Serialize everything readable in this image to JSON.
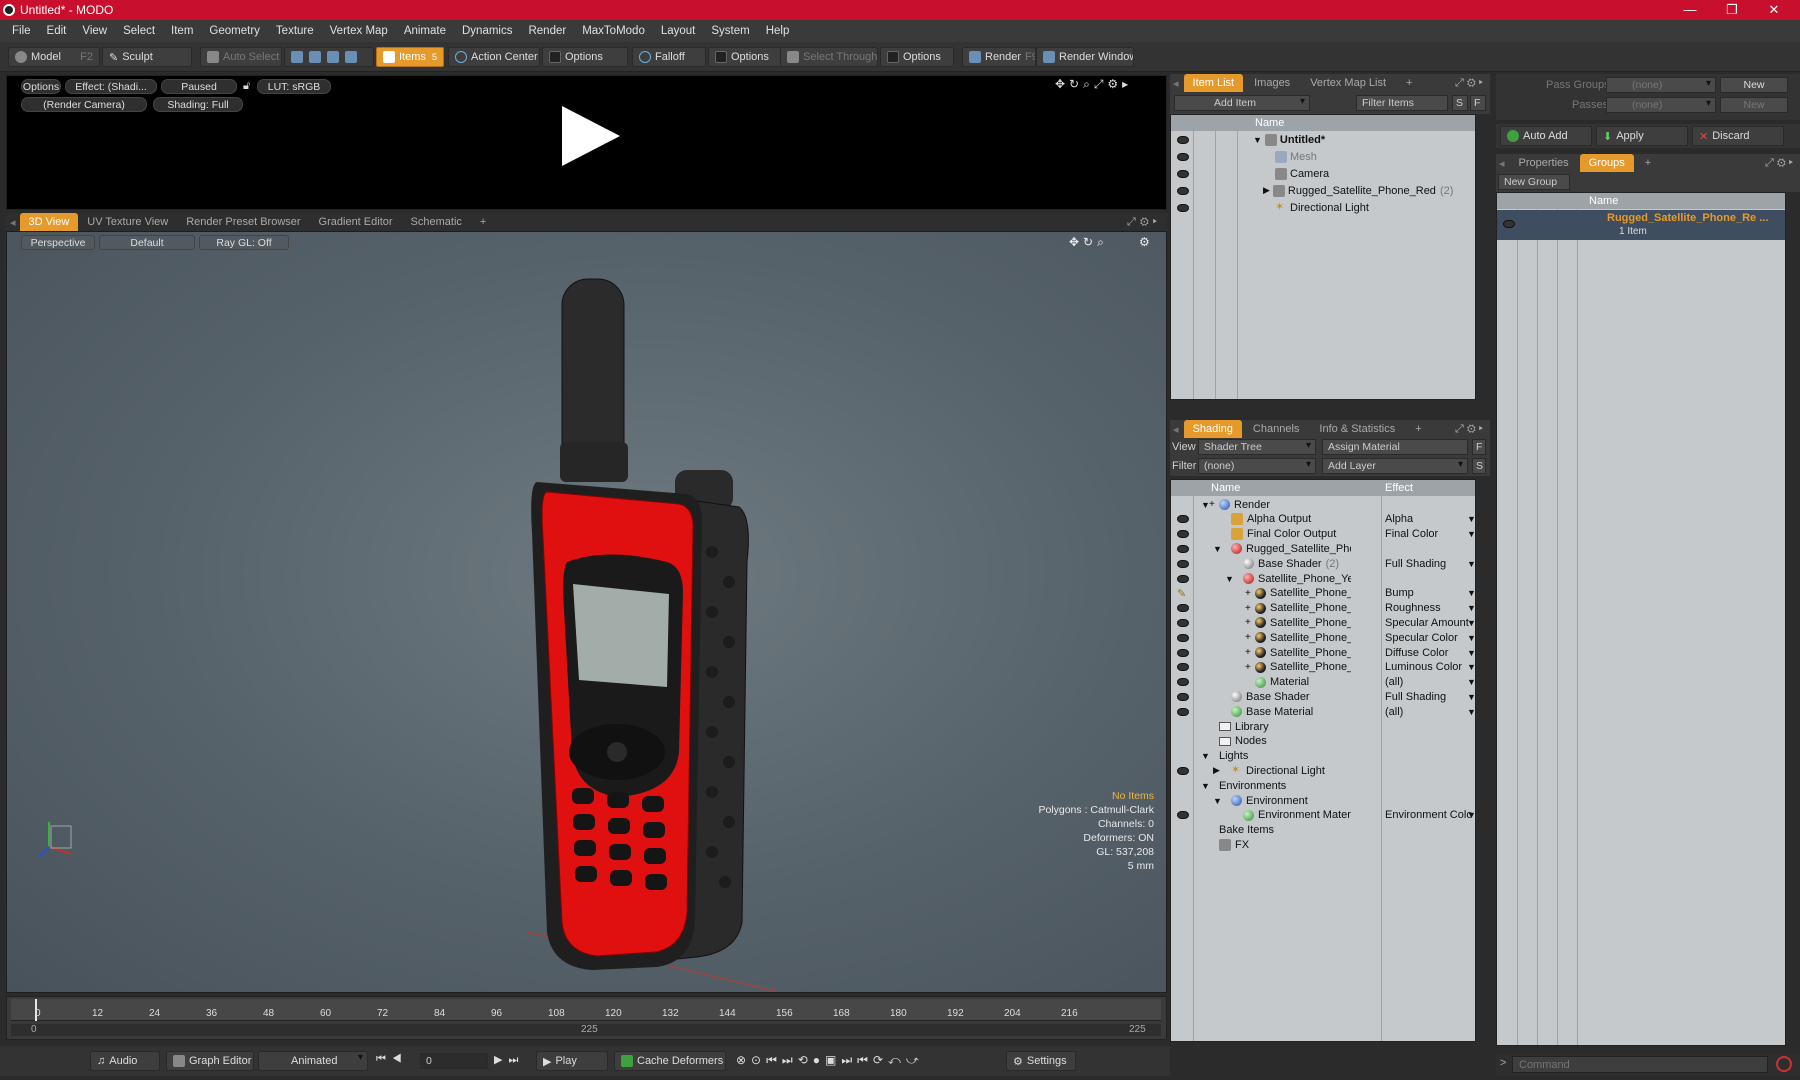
{
  "window": {
    "title": "Untitled* - MODO",
    "controls": [
      "—",
      "❐",
      "✕"
    ]
  },
  "menu": [
    "File",
    "Edit",
    "View",
    "Select",
    "Item",
    "Geometry",
    "Texture",
    "Vertex Map",
    "Animate",
    "Dynamics",
    "Render",
    "MaxToModo",
    "Layout",
    "System",
    "Help"
  ],
  "toolbar": {
    "model": "Model",
    "model_key": "F2",
    "sculpt": "Sculpt",
    "auto_select": "Auto Select",
    "items": "Items",
    "items_key": "5",
    "action_center": "Action Center",
    "options1": "Options",
    "falloff": "Falloff",
    "options2": "Options",
    "select_through": "Select Through",
    "options3": "Options",
    "render": "Render",
    "render_key": "F9",
    "render_window": "Render Window"
  },
  "render_preview": {
    "options": "Options",
    "effect": "Effect: (Shadi...",
    "paused": "Paused",
    "lut": "LUT: sRGB",
    "camera": "(Render Camera)",
    "shading": "Shading: Full"
  },
  "viewport_tabs": [
    "3D View",
    "UV Texture View",
    "Render Preset Browser",
    "Gradient Editor",
    "Schematic",
    "+"
  ],
  "viewport": {
    "perspective": "Perspective",
    "default": "Default",
    "raygl": "Ray GL: Off",
    "status": {
      "no_items": "No Items",
      "polygons": "Polygons : Catmull-Clark",
      "channels": "Channels: 0",
      "deformers": "Deformers: ON",
      "gl": "GL: 537,208",
      "scale": "5 mm"
    }
  },
  "timeline": {
    "ticks": [
      "0",
      "12",
      "24",
      "36",
      "48",
      "60",
      "72",
      "84",
      "96",
      "108",
      "120",
      "132",
      "144",
      "156",
      "168",
      "180",
      "192",
      "204",
      "216"
    ],
    "start": "0",
    "mid": "225",
    "end": "225"
  },
  "bottombar": {
    "audio": "Audio",
    "graph_editor": "Graph Editor",
    "animated": "Animated",
    "frame": "0",
    "play": "Play",
    "cache_deformers": "Cache Deformers",
    "settings": "Settings"
  },
  "item_list": {
    "tabs": [
      "Item List",
      "Images",
      "Vertex Map List",
      "+"
    ],
    "add_item": "Add Item",
    "filter_items": "Filter Items",
    "s": "S",
    "f": "F",
    "name_col": "Name",
    "rows": [
      {
        "label": "Untitled*",
        "bold": true
      },
      {
        "label": "Mesh",
        "dim": true
      },
      {
        "label": "Camera"
      },
      {
        "label": "Rugged_Satellite_Phone_Red",
        "suffix": "(2)"
      },
      {
        "label": "Directional Light"
      }
    ]
  },
  "groups_panel": {
    "pass_groups": "Pass Groups",
    "passes": "Passes",
    "none": "(none)",
    "new": "New",
    "auto_add": "Auto Add",
    "apply": "Apply",
    "discard": "Discard",
    "tabs": [
      "Properties",
      "Groups",
      "+"
    ],
    "new_group": "New Group",
    "name_col": "Name",
    "group_name": "Rugged_Satellite_Phone_Re ...",
    "group_count": "1 Item"
  },
  "shading": {
    "tabs": [
      "Shading",
      "Channels",
      "Info & Statistics",
      "+"
    ],
    "view_label": "View",
    "view_value": "Shader Tree",
    "assign_material": "Assign Material",
    "f": "F",
    "filter_label": "Filter",
    "filter_value": "(none)",
    "add_layer": "Add Layer",
    "s": "S",
    "name_col": "Name",
    "effect_col": "Effect",
    "rows": [
      {
        "name": "Render",
        "effect": "",
        "indent": 0
      },
      {
        "name": "Alpha Output",
        "effect": "Alpha",
        "indent": 1
      },
      {
        "name": "Final Color Output",
        "effect": "Final Color",
        "indent": 1
      },
      {
        "name": "Rugged_Satellite_Phone_ ...",
        "effect": "",
        "indent": 1
      },
      {
        "name": "Base Shader",
        "suffix": "(2)",
        "effect": "Full Shading",
        "indent": 2
      },
      {
        "name": "Satellite_Phone_Yellow",
        "suffix": "(...",
        "effect": "",
        "indent": 2
      },
      {
        "name": "Satellite_Phone_Yello ...",
        "effect": "Bump",
        "indent": 3
      },
      {
        "name": "Satellite_Phone_Gloss...",
        "effect": "Roughness",
        "indent": 3
      },
      {
        "name": "Satellite_Phone_Refle...",
        "effect": "Specular Amount",
        "indent": 3
      },
      {
        "name": "Satellite_Phone_Refle...",
        "effect": "Specular Color",
        "indent": 3
      },
      {
        "name": "Satellite_Phone_Yello ...",
        "effect": "Diffuse Color",
        "indent": 3
      },
      {
        "name": "Satellite_Phone_Emis ...",
        "effect": "Luminous Color",
        "indent": 3
      },
      {
        "name": "Material",
        "effect": "(all)",
        "indent": 3
      },
      {
        "name": "Base Shader",
        "effect": "Full Shading",
        "indent": 1
      },
      {
        "name": "Base Material",
        "effect": "(all)",
        "indent": 1
      },
      {
        "name": "Library",
        "effect": "",
        "indent": 0
      },
      {
        "name": "Nodes",
        "effect": "",
        "indent": 0
      },
      {
        "name": "Lights",
        "effect": "",
        "indent": 0
      },
      {
        "name": "Directional Light",
        "effect": "",
        "indent": 1
      },
      {
        "name": "Environments",
        "effect": "",
        "indent": 0
      },
      {
        "name": "Environment",
        "effect": "",
        "indent": 1
      },
      {
        "name": "Environment Material",
        "effect": "Environment Color",
        "indent": 2
      },
      {
        "name": "Bake Items",
        "effect": "",
        "indent": 0
      },
      {
        "name": "FX",
        "effect": "",
        "indent": 0
      }
    ]
  },
  "command": {
    "placeholder": "Command"
  },
  "colors": {
    "accent": "#e69a2b",
    "titlebar": "#c8102e",
    "phone_red": "#e01010"
  }
}
